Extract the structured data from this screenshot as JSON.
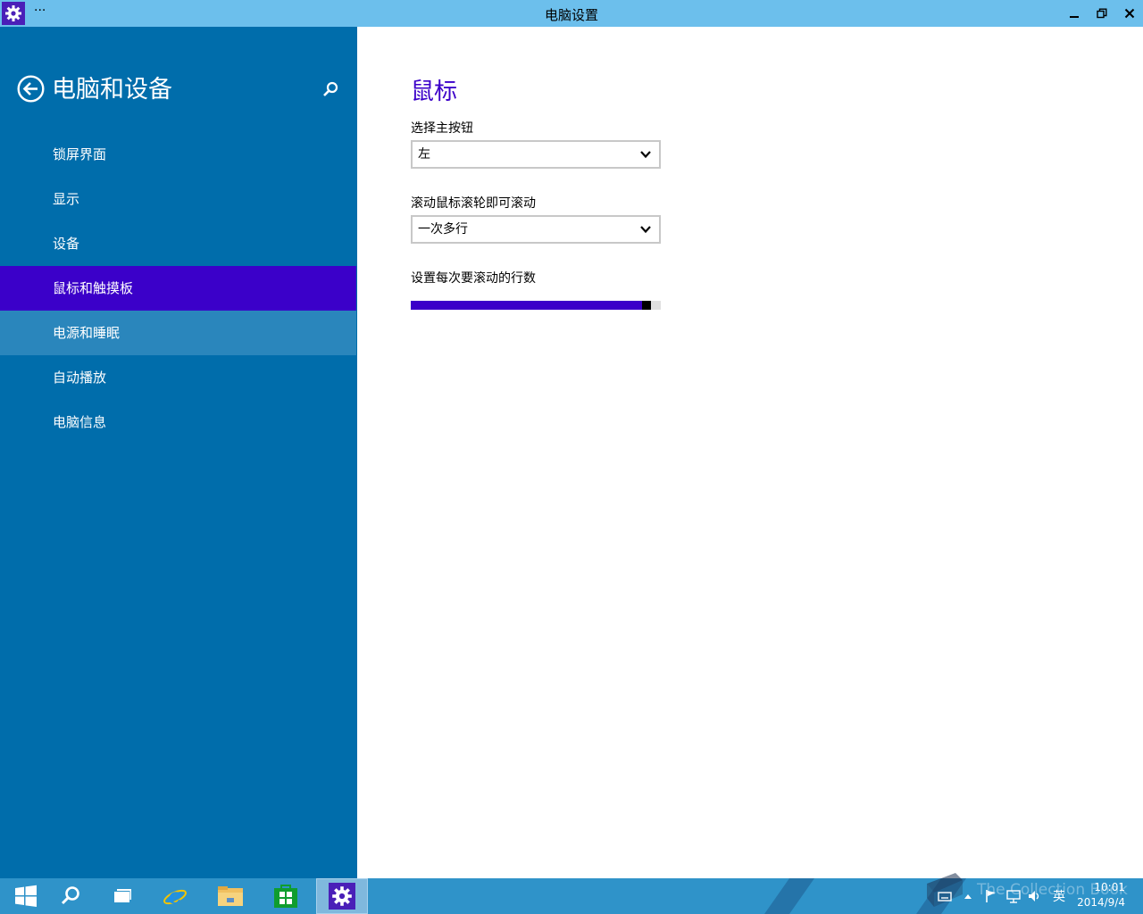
{
  "window": {
    "title": "电脑设置",
    "menu_glyph": "···",
    "accent": "#3b00c9",
    "titlebar_color": "#6cbfec"
  },
  "sidebar": {
    "title": "电脑和设备",
    "back_icon": "back-arrow-icon",
    "search_icon": "search-icon",
    "items": [
      {
        "label": "锁屏界面",
        "state": "normal"
      },
      {
        "label": "显示",
        "state": "normal"
      },
      {
        "label": "设备",
        "state": "normal"
      },
      {
        "label": "鼠标和触摸板",
        "state": "selected"
      },
      {
        "label": "电源和睡眠",
        "state": "hover"
      },
      {
        "label": "自动播放",
        "state": "normal"
      },
      {
        "label": "电脑信息",
        "state": "normal"
      }
    ],
    "background": "#006dab"
  },
  "main": {
    "title": "鼠标",
    "primary_button": {
      "label": "选择主按钮",
      "value": "左"
    },
    "scroll_mode": {
      "label": "滚动鼠标滚轮即可滚动",
      "value": "一次多行"
    },
    "lines_slider": {
      "label": "设置每次要滚动的行数",
      "level_fraction": 0.96
    }
  },
  "taskbar": {
    "buttons": [
      {
        "name": "start-button",
        "icon": "windows-logo-icon"
      },
      {
        "name": "search-button",
        "icon": "search-icon"
      },
      {
        "name": "task-view-button",
        "icon": "task-view-icon"
      },
      {
        "name": "internet-explorer-button",
        "icon": "ie-icon"
      },
      {
        "name": "file-explorer-button",
        "icon": "folder-icon"
      },
      {
        "name": "store-button",
        "icon": "store-icon"
      },
      {
        "name": "pc-settings-button",
        "icon": "gear-icon",
        "active": true
      }
    ],
    "tray": {
      "ime": "英",
      "watermark": "The Collection Book",
      "time": "10:01",
      "date": "2014/9/4"
    }
  }
}
